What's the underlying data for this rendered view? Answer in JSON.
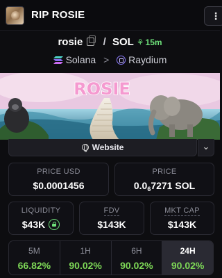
{
  "header": {
    "title": "RIP ROSIE",
    "menu_icon": "more-vertical-icon"
  },
  "pair": {
    "token": "rosie",
    "quote": "SOL",
    "separator": "/",
    "age": "15m",
    "copy_icon": "copy-icon",
    "age_icon": "sprout-icon"
  },
  "chain": {
    "network": "Solana",
    "dex": "Raydium",
    "separator": ">"
  },
  "banner": {
    "logo_text": "ROSIE"
  },
  "website": {
    "label": "Website"
  },
  "stats": {
    "price_usd": {
      "label": "PRICE USD",
      "value": "$0.0001456"
    },
    "price_native": {
      "label": "PRICE",
      "value_prefix": "0.0",
      "value_zeros": "6",
      "value_suffix": "7271 SOL"
    },
    "liquidity": {
      "label": "LIQUIDITY",
      "value": "$43K"
    },
    "fdv": {
      "label": "FDV",
      "value": "$143K"
    },
    "mkt_cap": {
      "label": "MKT CAP",
      "value": "$143K"
    }
  },
  "timeframes": [
    {
      "label": "5M",
      "change": "66.82%",
      "active": false
    },
    {
      "label": "1H",
      "change": "90.02%",
      "active": false
    },
    {
      "label": "6H",
      "change": "90.02%",
      "active": false
    },
    {
      "label": "24H",
      "change": "90.02%",
      "active": true
    }
  ],
  "colors": {
    "positive": "#7ed957",
    "accent_green": "#6ee07a",
    "background": "#0d0d10"
  }
}
